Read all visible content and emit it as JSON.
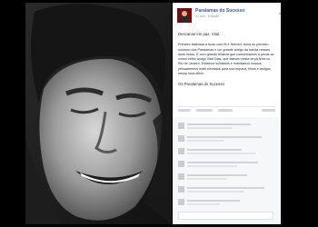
{
  "post": {
    "page_name": "Paralamas do Sucesso",
    "meta": "21 min · Editado · ",
    "paragraphs": [
      "Descanse em paz, Vital.",
      "Primeiro baterista a tocar com Bi e Herbert, tema do primeiro sucesso dos Paralamas e um grande amigo da banda nesses anos todos. É com grande tristeza que comunicamos a perda do nosso velho amigo Vital Dias, que faleceu nesta terça-feira no Rio de Janeiro. Estamos solidários e mandamos nossos pensamentos mais elevados para sua esposa, filhos e amigos nessa hora difícil.",
      "Os Paralamas do Sucesso"
    ]
  },
  "colors": {
    "link": "#3b5998",
    "background": "#000000"
  },
  "icons": {
    "close": "close-icon",
    "avatar": "page-avatar-image"
  }
}
